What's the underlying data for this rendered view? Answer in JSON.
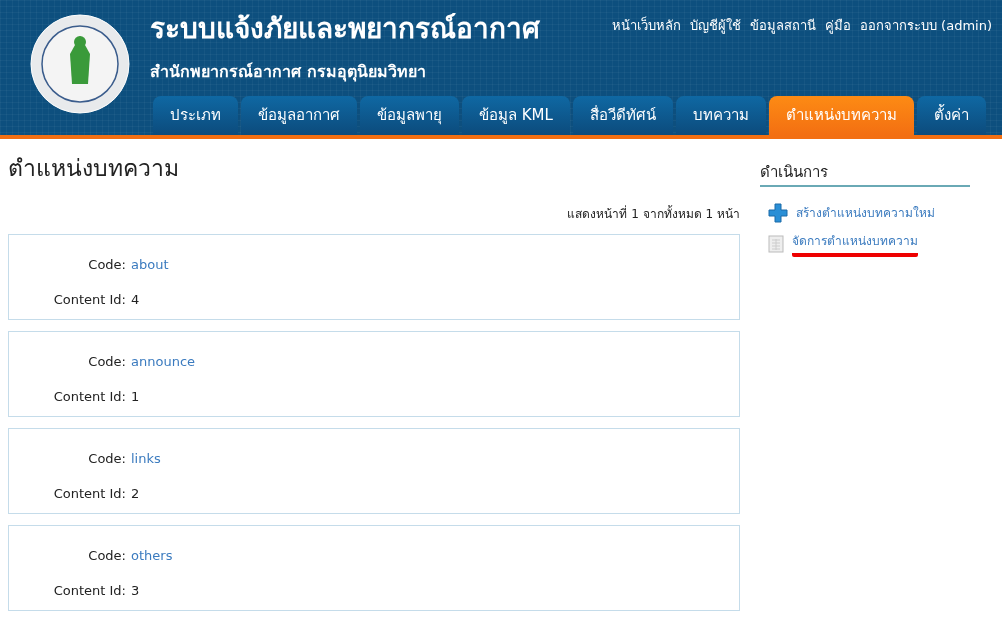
{
  "header": {
    "title": "ระบบแจ้งภัยและพยากรณ์อากาศ",
    "subtitle": "สำนักพยากรณ์อากาศ กรมอุตุนิยมวิทยา",
    "top_links": [
      "หน้าเว็บหลัก",
      "บัญชีผู้ใช้",
      "ข้อมูลสถานี",
      "คู่มือ",
      "ออกจากระบบ (admin)"
    ],
    "tabs": [
      {
        "label": "ประเภท",
        "selected": false
      },
      {
        "label": "ข้อมูลอากาศ",
        "selected": false
      },
      {
        "label": "ข้อมูลพายุ",
        "selected": false
      },
      {
        "label": "ข้อมูล KML",
        "selected": false
      },
      {
        "label": "สื่อวีดีทัศน์",
        "selected": false
      },
      {
        "label": "บทความ",
        "selected": false
      },
      {
        "label": "ตำแหน่งบทความ",
        "selected": true
      },
      {
        "label": "ตั้งค่า",
        "selected": false
      }
    ]
  },
  "main": {
    "title": "ตำแหน่งบทความ",
    "pager": "แสดงหน้าที่ 1 จากทั้งหมด 1 หน้า",
    "records": [
      {
        "code_label": "Code:",
        "code": "about",
        "id_label": "Content Id:",
        "id": "4"
      },
      {
        "code_label": "Code:",
        "code": "announce",
        "id_label": "Content Id:",
        "id": "1"
      },
      {
        "code_label": "Code:",
        "code": "links",
        "id_label": "Content Id:",
        "id": "2"
      },
      {
        "code_label": "Code:",
        "code": "others",
        "id_label": "Content Id:",
        "id": "3"
      }
    ]
  },
  "sidebar": {
    "title": "ดำเนินการ",
    "actions": [
      {
        "kind": "create",
        "label": "สร้างตำแหน่งบทความใหม่",
        "highlighted": false
      },
      {
        "kind": "manage",
        "label": "จัดการตำแหน่งบทความ",
        "highlighted": true
      }
    ]
  }
}
